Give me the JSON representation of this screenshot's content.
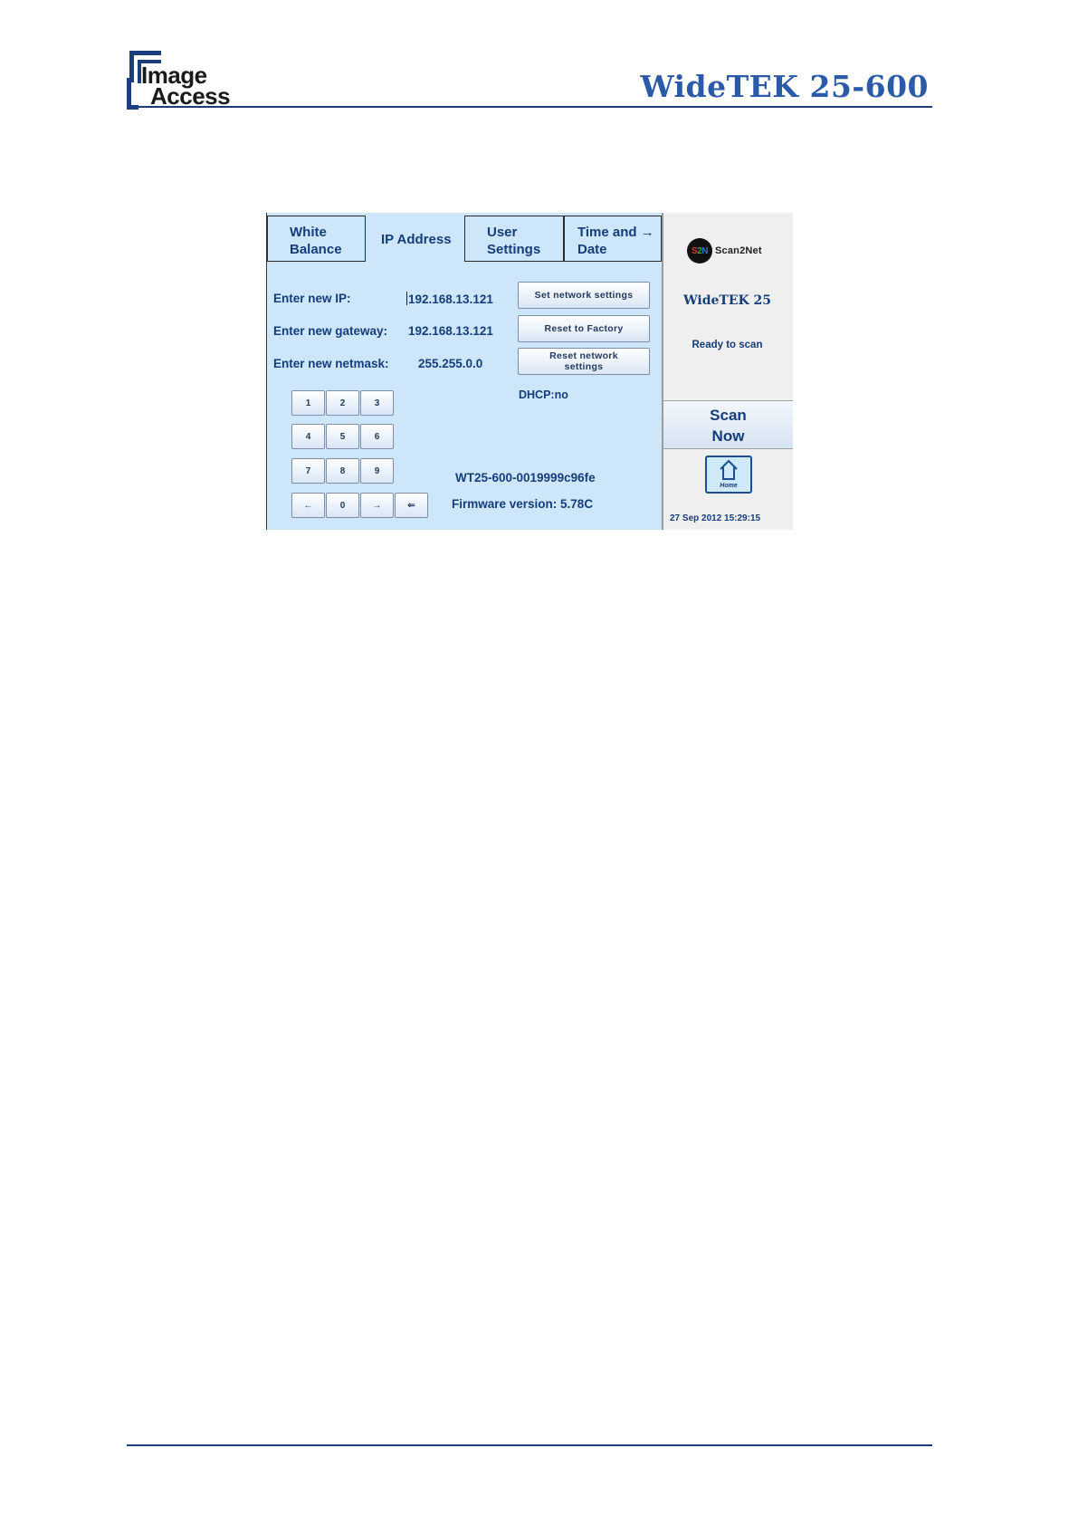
{
  "header": {
    "logo_word_1": "Image",
    "logo_word_2": "Access",
    "product_title": "WideTEK 25-600"
  },
  "tabs": [
    {
      "line1": "White",
      "line2": "Balance",
      "active": false
    },
    {
      "line1": "IP Address",
      "line2": "",
      "active": true
    },
    {
      "line1": "User",
      "line2": "Settings",
      "active": false
    },
    {
      "line1": "Time and →",
      "line2": "Date",
      "active": false
    }
  ],
  "network": {
    "ip_label": "Enter new IP:",
    "ip_value": "192.168.13.121",
    "gateway_label": "Enter new gateway:",
    "gateway_value": "192.168.13.121",
    "netmask_label": "Enter new netmask:",
    "netmask_value": "255.255.0.0",
    "dhcp": "DHCP:no"
  },
  "buttons": {
    "set_network": "Set network settings",
    "reset_factory": "Reset to Factory",
    "reset_network_line1": "Reset network",
    "reset_network_line2": "settings"
  },
  "keypad": {
    "k1": "1",
    "k2": "2",
    "k3": "3",
    "k4": "4",
    "k5": "5",
    "k6": "6",
    "k7": "7",
    "k8": "8",
    "k9": "9",
    "left": "←",
    "k0": "0",
    "right": "→",
    "backspace": "⇐"
  },
  "device": {
    "serial": "WT25-600-0019999c96fe",
    "firmware": "Firmware version: 5.78C"
  },
  "side": {
    "brand_s": "S",
    "brand_2": "2",
    "brand_n": "N",
    "brand_text": "Scan2Net",
    "model": "WideTEK 25",
    "status": "Ready to scan",
    "scan_line1": "Scan",
    "scan_line2": "Now",
    "home_label": "Home",
    "home_icon": "house-icon",
    "datetime": "27 Sep 2012 15:29:15"
  }
}
